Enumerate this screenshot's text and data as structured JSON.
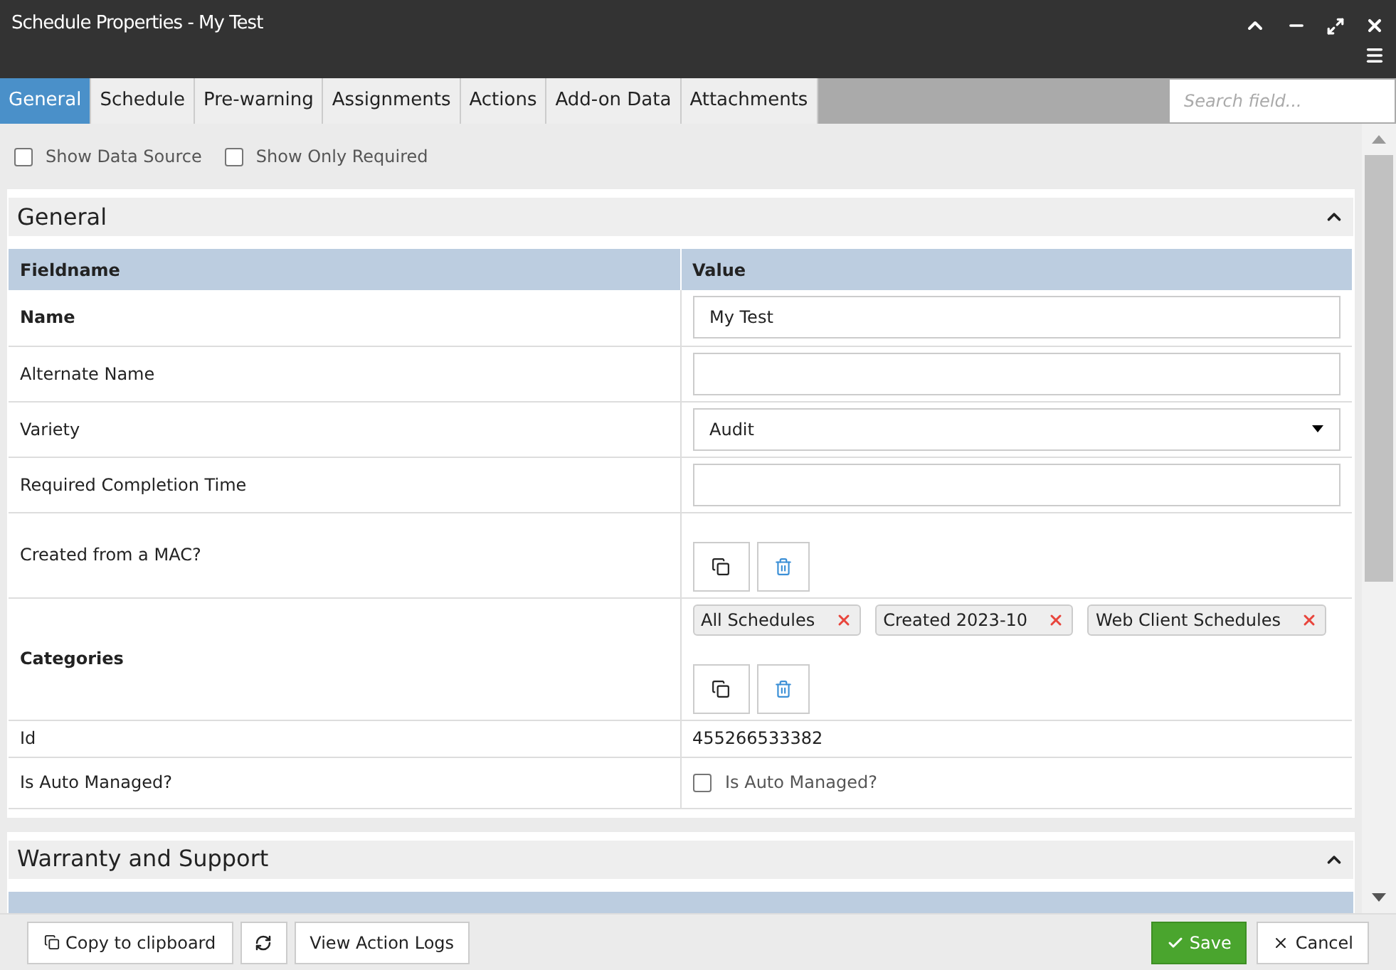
{
  "window": {
    "title": "Schedule Properties - My Test"
  },
  "tabs": [
    {
      "label": "General",
      "selected": true
    },
    {
      "label": "Schedule",
      "selected": false
    },
    {
      "label": "Pre-warning",
      "selected": false
    },
    {
      "label": "Assignments",
      "selected": false
    },
    {
      "label": "Actions",
      "selected": false
    },
    {
      "label": "Add-on Data",
      "selected": false
    },
    {
      "label": "Attachments",
      "selected": false
    }
  ],
  "search": {
    "placeholder": "Search field..."
  },
  "options": [
    {
      "label": "Show Data Source",
      "checked": false
    },
    {
      "label": "Show Only Required",
      "checked": false
    }
  ],
  "sections": [
    {
      "title": "General",
      "expanded": true,
      "columns": [
        "Fieldname",
        "Value"
      ],
      "rows": [
        {
          "name": "Name",
          "required": true,
          "kind": "text",
          "value": "My Test"
        },
        {
          "name": "Alternate Name",
          "required": false,
          "kind": "text",
          "value": ""
        },
        {
          "name": "Variety",
          "required": false,
          "kind": "select",
          "value": "Audit"
        },
        {
          "name": "Required Completion Time",
          "required": false,
          "kind": "text",
          "value": ""
        },
        {
          "name": "Created from a MAC?",
          "required": false,
          "kind": "buttons"
        },
        {
          "name": "Categories",
          "required": true,
          "kind": "tags",
          "tags": [
            "All Schedules",
            "Created 2023-10",
            "Web Client Schedules"
          ]
        },
        {
          "name": "Id",
          "required": false,
          "kind": "plain",
          "value": "455266533382"
        },
        {
          "name": "Is Auto Managed?",
          "required": false,
          "kind": "checkbox",
          "label": "Is Auto Managed?",
          "checked": false
        }
      ]
    },
    {
      "title": "Warranty and Support",
      "expanded": true
    }
  ],
  "footer": {
    "left": [
      {
        "kind": "copy",
        "label": "Copy to clipboard"
      },
      {
        "kind": "refresh"
      },
      {
        "kind": "plain",
        "label": "View Action Logs"
      }
    ],
    "right": [
      {
        "kind": "primary",
        "label": "Save"
      },
      {
        "kind": "cancel",
        "label": "Cancel"
      }
    ]
  }
}
